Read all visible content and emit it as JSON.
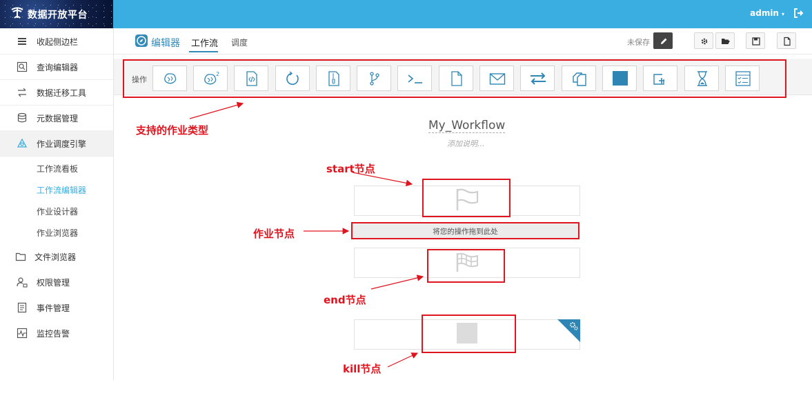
{
  "app": {
    "title": "数据开放平台",
    "logo_mark": "ᖰ"
  },
  "user": {
    "name": "admin",
    "caret": "▾"
  },
  "sidebar": {
    "items": [
      {
        "label": "收起侧边栏",
        "icon": "hamburger-icon"
      },
      {
        "label": "查询编辑器",
        "icon": "query-icon"
      },
      {
        "label": "数据迁移工具",
        "icon": "transfer-icon"
      },
      {
        "label": "元数据管理",
        "icon": "database-icon"
      },
      {
        "label": "作业调度引擎",
        "icon": "scheduler-icon"
      },
      {
        "label": "文件浏览器",
        "icon": "folder-icon"
      },
      {
        "label": "权限管理",
        "icon": "user-lock-icon"
      },
      {
        "label": "事件管理",
        "icon": "document-icon"
      },
      {
        "label": "监控告警",
        "icon": "monitor-icon"
      }
    ],
    "subitems": [
      "工作流看板",
      "工作流编辑器",
      "作业设计器",
      "作业浏览器"
    ]
  },
  "header": {
    "editor_label": "编辑器",
    "tab_workflow": "工作流",
    "tab_schedule": "调度",
    "unsaved": "未保存"
  },
  "toolbar": {
    "label": "操作",
    "tools": [
      "hive-icon",
      "hive2-icon",
      "java-icon",
      "spark-icon",
      "pig-icon",
      "git-branch-icon",
      "shell-icon",
      "file-icon",
      "email-icon",
      "distcp-icon",
      "copy-icon",
      "stop-icon",
      "subworkflow-icon",
      "hourglass-icon",
      "checklist-icon"
    ]
  },
  "workflow": {
    "name": "My_Workflow",
    "description_placeholder": "添加说明...",
    "drop_text": "将您的操作拖到此处"
  },
  "annotations": {
    "job_types": "支持的作业类型",
    "start_node": "start节点",
    "job_node": "作业节点",
    "end_node": "end节点",
    "kill_node": "kill节点"
  },
  "colors": {
    "topbar": "#3aaee0",
    "accent": "#338bb8",
    "annotation": "#e0141e"
  }
}
